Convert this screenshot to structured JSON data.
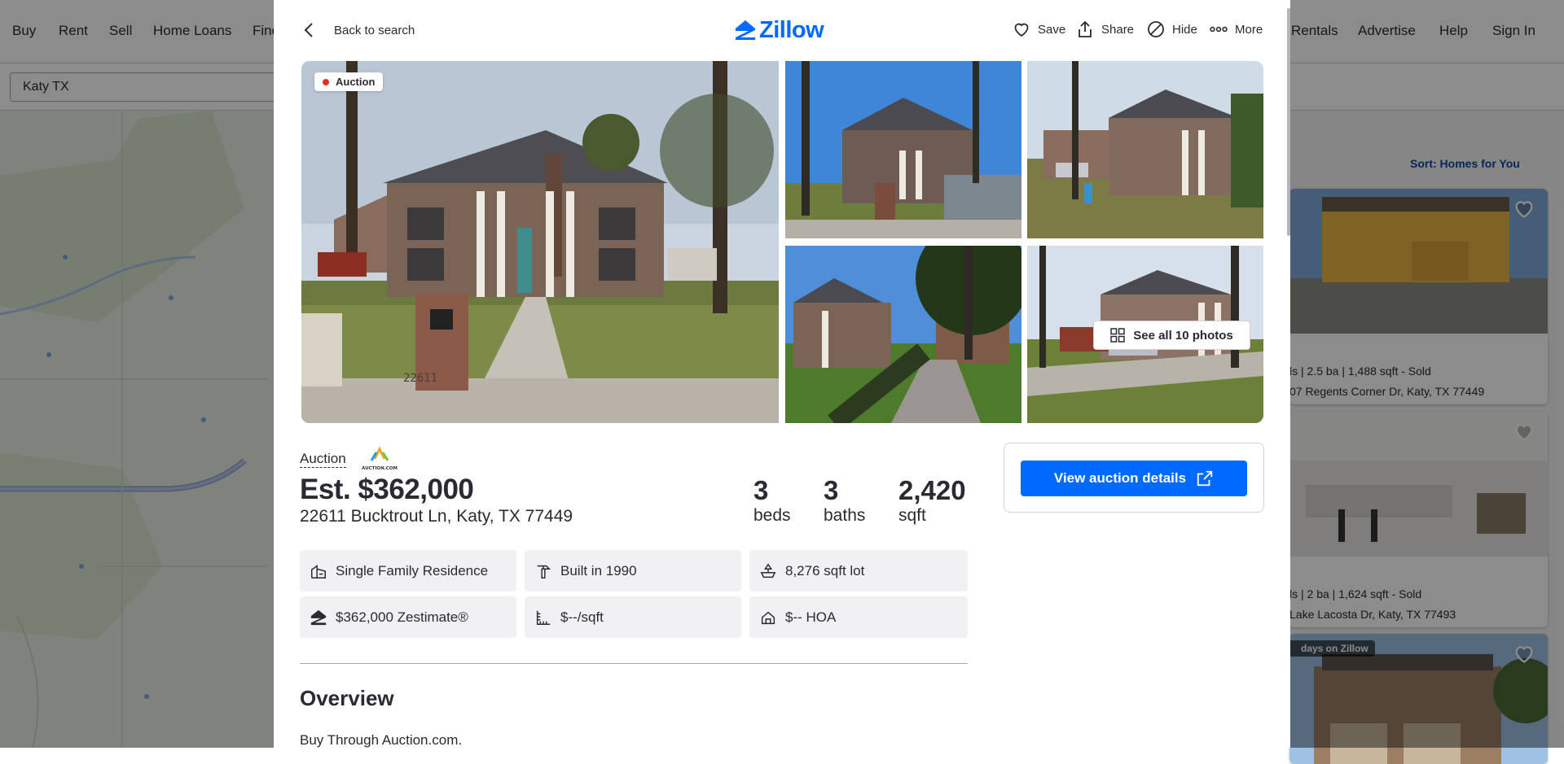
{
  "background": {
    "nav_left": [
      "Buy",
      "Rent",
      "Sell",
      "Home Loans",
      "Find"
    ],
    "nav_right": [
      "Rentals",
      "Advertise",
      "Help",
      "Sign In"
    ],
    "search_value": "Katy TX",
    "sort_label": "Sort: Homes for You",
    "cards": [
      {
        "stats": "ls | 2.5 ba | 1,488 sqft - Sold",
        "address": "07 Regents Corner Dr, Katy, TX 77449"
      },
      {
        "stats": "ls | 2 ba | 1,624 sqft - Sold",
        "address": "Lake Lacosta Dr, Katy, TX 77493"
      },
      {
        "badge": "days on Zillow"
      }
    ]
  },
  "header": {
    "back_label": "Back to search",
    "logo_text": "Zillow",
    "save_label": "Save",
    "share_label": "Share",
    "hide_label": "Hide",
    "more_label": "More"
  },
  "gallery": {
    "badge": "Auction",
    "see_all_label": "See all 10 photos",
    "house_number": "22611"
  },
  "listing": {
    "auction_label": "Auction",
    "auction_logo_text": "AUCTION.COM",
    "price": "Est. $362,000",
    "address": "22611 Bucktrout Ln, Katy, TX 77449",
    "beds": "3",
    "beds_label": "beds",
    "baths": "3",
    "baths_label": "baths",
    "sqft": "2,420",
    "sqft_label": "sqft",
    "facts": {
      "type": "Single Family Residence",
      "built": "Built in 1990",
      "lot": "8,276 sqft lot",
      "zestimate": "$362,000 Zestimate®",
      "price_sqft": "$--/sqft",
      "hoa": "$-- HOA"
    },
    "cta_label": "View auction details",
    "overview_title": "Overview",
    "overview_text": "Buy Through Auction.com."
  },
  "colors": {
    "brand": "#006aff",
    "text": "#2a2a33",
    "auction_dot": "#e4301e"
  }
}
